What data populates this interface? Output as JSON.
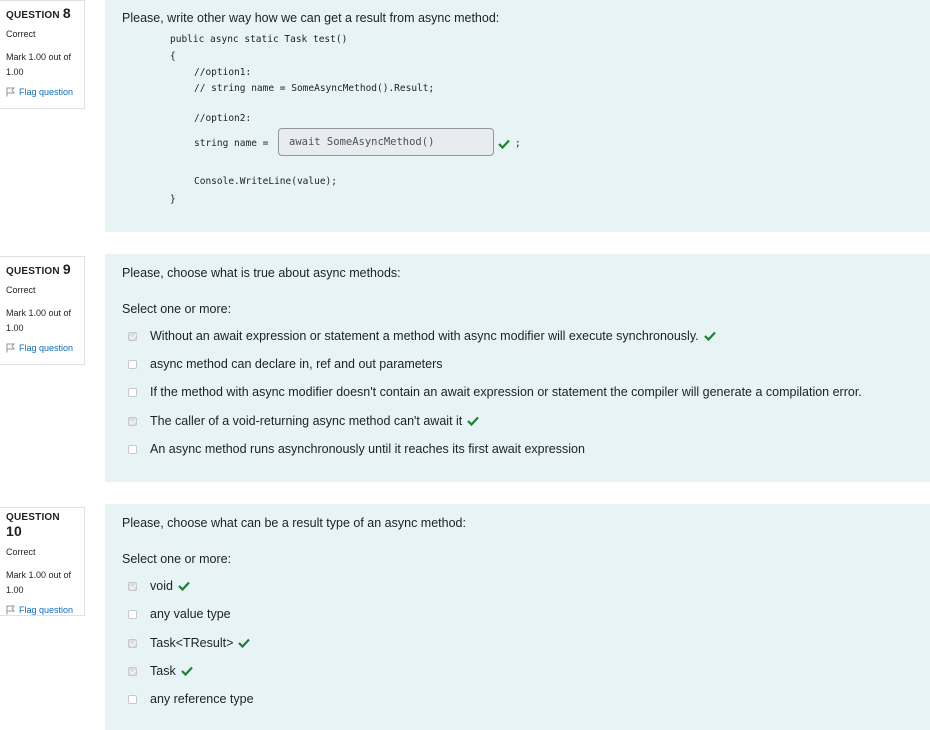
{
  "colors": {
    "correct": "#1f7e39",
    "flag": "#0f6cbf",
    "panel": "#e7f3f5"
  },
  "questions": [
    {
      "label": "QUESTION",
      "number": "8",
      "state": "Correct",
      "grade": "Mark 1.00 out of 1.00",
      "flag": "Flag question",
      "text": "Please, write other way how we can get a result from async method:",
      "code": {
        "line1": "public async static Task test()",
        "line2": "{",
        "line3": "//option1:",
        "line4": "// string name = SomeAsyncMethod().Result;",
        "line5": "//option2:",
        "line6": "string name =",
        "line7": ";",
        "line8": "Console.WriteLine(value);",
        "line9": "}"
      },
      "answer": "await SomeAsyncMethod()"
    },
    {
      "label": "QUESTION",
      "number": "9",
      "state": "Correct",
      "grade": "Mark 1.00 out of 1.00",
      "flag": "Flag question",
      "text": "Please, choose what is true about async methods:",
      "prompt": "Select one or more:",
      "options": [
        {
          "label": "Without an await expression or statement a method with async modifier will execute synchronously.",
          "checked": true
        },
        {
          "label": "async method can declare in, ref and out parameters",
          "checked": false
        },
        {
          "label": "If the method with async modifier doesn't contain an await expression or statement the compiler will generate a compilation error.",
          "checked": false
        },
        {
          "label": "The caller of a void-returning async method can't await it",
          "checked": true
        },
        {
          "label": "An async method runs asynchronously until it reaches its first await expression",
          "checked": false
        }
      ]
    },
    {
      "label": "QUESTION",
      "number": "10",
      "state": "Correct",
      "grade": "Mark 1.00 out of 1.00",
      "flag": "Flag question",
      "text": "Please, choose what can be a result type of an async method:",
      "prompt": "Select one or more:",
      "options": [
        {
          "label": "void",
          "checked": true
        },
        {
          "label": "any value type",
          "checked": false
        },
        {
          "label": "Task<TResult>",
          "checked": true
        },
        {
          "label": "Task",
          "checked": true
        },
        {
          "label": "any reference type",
          "checked": false
        }
      ]
    }
  ]
}
